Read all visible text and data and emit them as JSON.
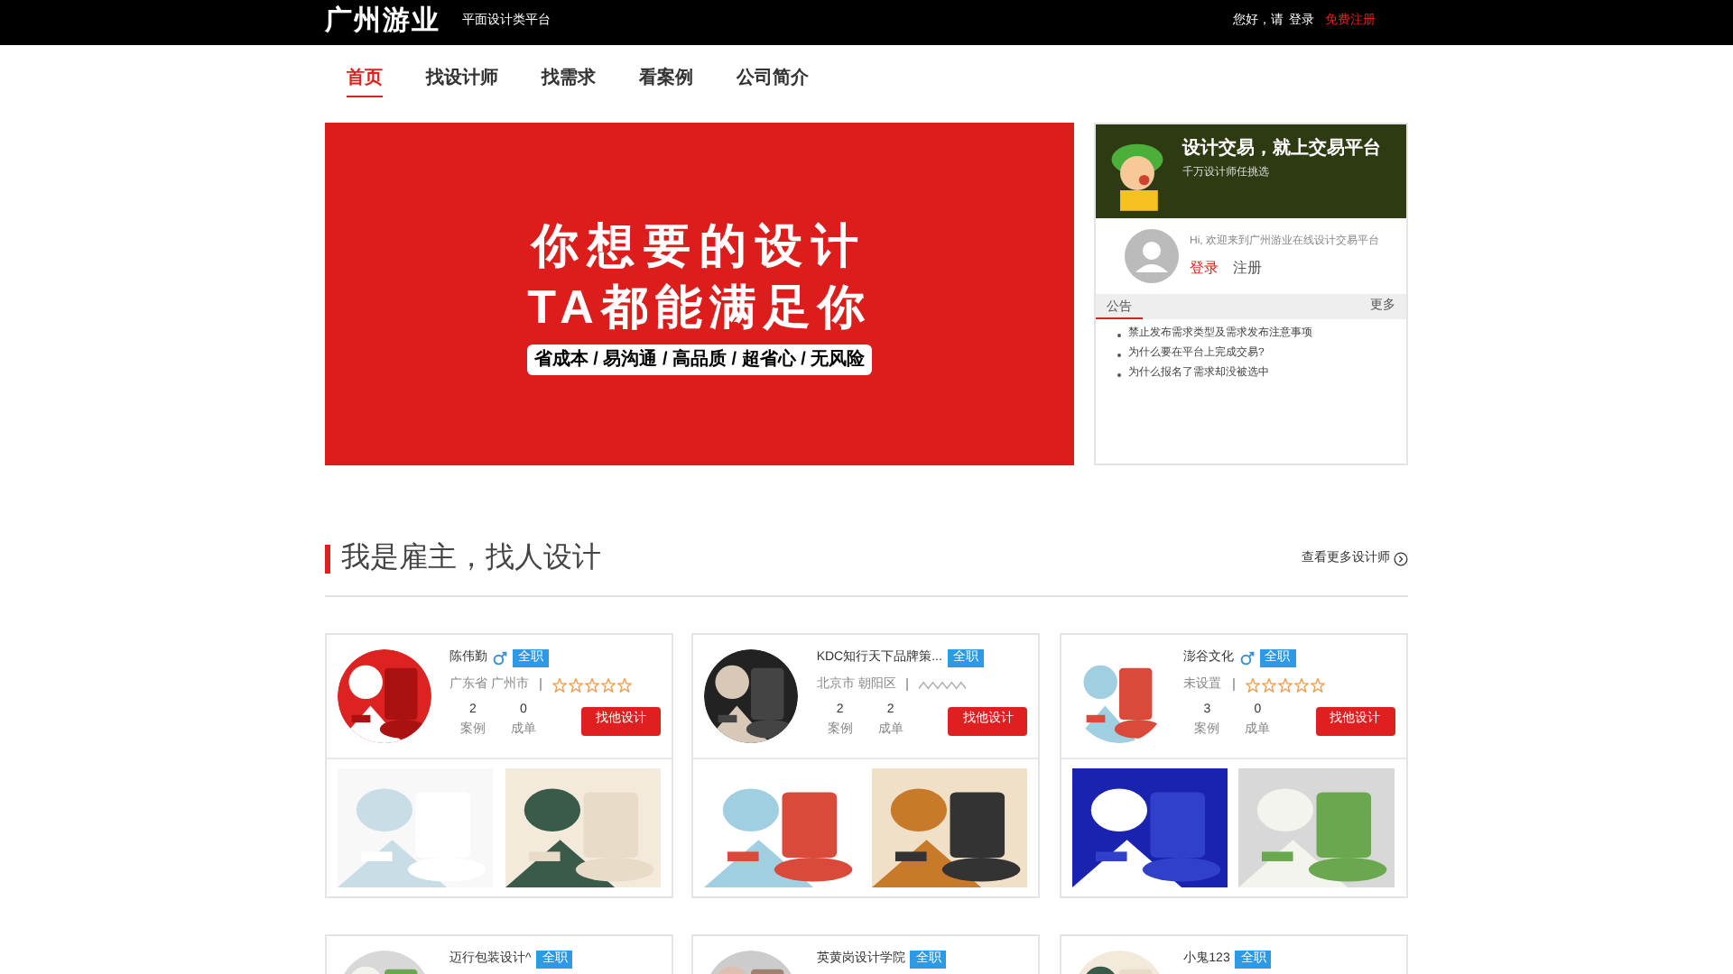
{
  "top_bar": {
    "logo": "广州游业",
    "tagline": "平面设计类平台",
    "greeting": "您好，请",
    "login": "登录",
    "register": "免费注册"
  },
  "nav": [
    {
      "label": "首页",
      "selected": true
    },
    {
      "label": "找设计师",
      "selected": false
    },
    {
      "label": "找需求",
      "selected": false
    },
    {
      "label": "看案例",
      "selected": false
    },
    {
      "label": "公司简介",
      "selected": false
    }
  ],
  "banner": {
    "line_1": "你想要的设计",
    "line_2": "TA都能满足你",
    "slogan": "省成本 / 易沟通 / 高品质 / 超省心 / 无风险"
  },
  "side_panel": {
    "title": "设计交易，就上交易平台",
    "subtitle": "千万设计师任挑选",
    "welcome": "Hi, 欢迎来到广州游业在线设计交易平台",
    "login": "登录",
    "register": "注册",
    "notice_tab": "公告",
    "more": "更多",
    "notices": [
      "禁止发布需求类型及需求发布注意事项",
      "为什么要在平台上完成交易?",
      "为什么报名了需求却没被选中"
    ]
  },
  "section": {
    "title": "我是雇主，找人设计",
    "more_link": "查看更多设计师"
  },
  "designers": [
    {
      "name": "陈伟勤",
      "male": true,
      "badge": "全职",
      "location": "广东省 广州市",
      "rating": {
        "kind": "stars",
        "stars": 0
      },
      "cases": "2",
      "cases_label": "案例",
      "deals": "0",
      "deals_label": "成单",
      "button": "找他设计"
    },
    {
      "name": "KDC知行天下品牌策...",
      "male": false,
      "badge": "全职",
      "location": "北京市 朝阳区",
      "rating": {
        "kind": "loading"
      },
      "cases": "2",
      "cases_label": "案例",
      "deals": "2",
      "deals_label": "成单",
      "button": "找他设计"
    },
    {
      "name": "澎谷文化",
      "male": true,
      "badge": "全职",
      "location": "未设置",
      "rating": {
        "kind": "stars",
        "stars": 0
      },
      "cases": "3",
      "cases_label": "案例",
      "deals": "0",
      "deals_label": "成单",
      "button": "找他设计"
    },
    {
      "name": "迈行包装设计^",
      "badge": "全职"
    },
    {
      "name": "英黄岗设计学院",
      "badge": "全职"
    },
    {
      "name": "小鬼123",
      "badge": "全职"
    }
  ]
}
